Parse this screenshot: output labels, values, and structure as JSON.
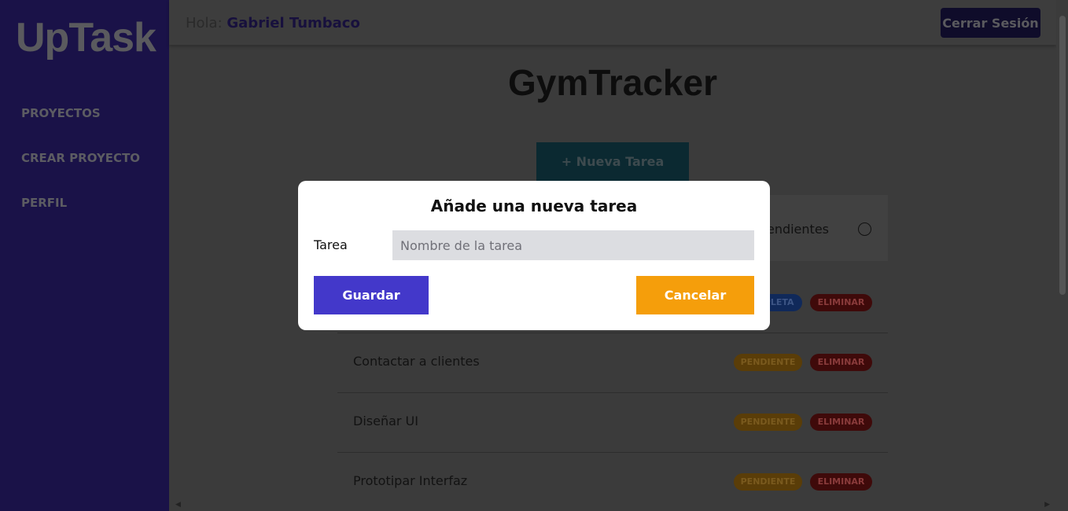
{
  "sidebar": {
    "logo": "UpTask",
    "items": [
      {
        "label": "PROYECTOS"
      },
      {
        "label": "CREAR PROYECTO"
      },
      {
        "label": "PERFIL"
      }
    ]
  },
  "header": {
    "greeting": "Hola:",
    "user_name": "Gabriel Tumbaco",
    "logout_label": "Cerrar Sesión"
  },
  "project": {
    "title": "GymTracker",
    "new_task_label": "+ Nueva Tarea",
    "filter_label": "Pendientes"
  },
  "tasks": [
    {
      "name": "",
      "status": "COMPLETA",
      "delete": "ELIMINAR"
    },
    {
      "name": "Contactar a clientes",
      "status": "PENDIENTE",
      "delete": "ELIMINAR"
    },
    {
      "name": "Diseñar UI",
      "status": "PENDIENTE",
      "delete": "ELIMINAR"
    },
    {
      "name": "Prototipar Interfaz",
      "status": "PENDIENTE",
      "delete": "ELIMINAR"
    }
  ],
  "modal": {
    "title": "Añade una nueva tarea",
    "field_label": "Tarea",
    "field_placeholder": "Nombre de la tarea",
    "field_value": "",
    "save_label": "Guardar",
    "cancel_label": "Cancelar"
  },
  "colors": {
    "primary": "#4338ca",
    "warning": "#f59e0b",
    "sidebar": "#1a1248"
  }
}
